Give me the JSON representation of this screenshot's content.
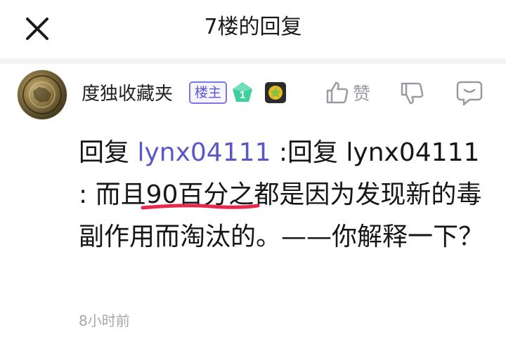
{
  "header": {
    "title": "7楼的回复",
    "close_icon": "close-icon"
  },
  "comment": {
    "username": "度独收藏夹",
    "owner_badge": "楼主",
    "level": "1",
    "actions": {
      "like_label": "赞"
    },
    "body": {
      "reply_prefix": "回复 ",
      "reply_target": "lynx04111",
      "part1": "  :回复 lynx04111 : 而且",
      "underlined": "90百分之都",
      "part2": "是因为发现新的毒副作用而淘汰的。——你解释一下？"
    },
    "timestamp": "8小时前"
  },
  "colors": {
    "accent": "#5b57c9",
    "underline": "#e8284a",
    "level_badge": "#3ecf9a"
  }
}
